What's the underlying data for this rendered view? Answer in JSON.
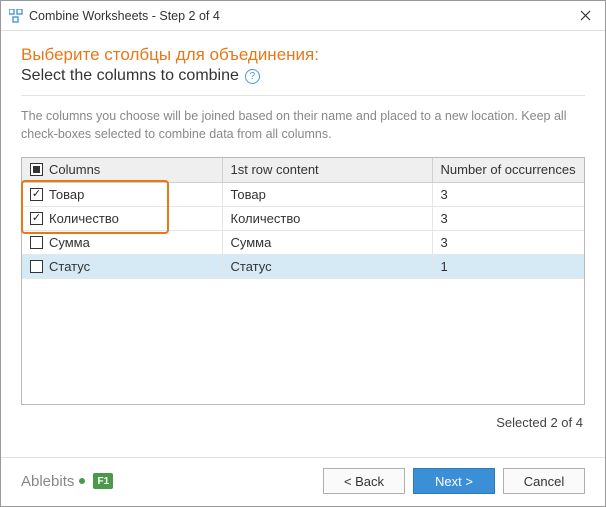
{
  "titlebar": {
    "title": "Combine Worksheets - Step 2 of 4"
  },
  "heading": {
    "ru": "Выберите столбцы для объединения:",
    "en": "Select the columns to combine"
  },
  "explain": "The columns you choose will be joined based on their name and placed to a new location. Keep all check-boxes selected to combine data from all columns.",
  "table": {
    "headers": {
      "col1": "Columns",
      "col2": "1st row content",
      "col3": "Number of occurrences"
    },
    "rows": [
      {
        "checked": true,
        "name": "Товар",
        "content": "Товар",
        "count": "3",
        "selected": false
      },
      {
        "checked": true,
        "name": "Количество",
        "content": "Количество",
        "count": "3",
        "selected": false
      },
      {
        "checked": false,
        "name": "Сумма",
        "content": "Сумма",
        "count": "3",
        "selected": false
      },
      {
        "checked": false,
        "name": "Статус",
        "content": "Статус",
        "count": "1",
        "selected": true
      }
    ]
  },
  "status": "Selected 2 of 4",
  "footer": {
    "brand": "Ablebits",
    "f1": "F1",
    "back": "< Back",
    "next": "Next >",
    "cancel": "Cancel"
  }
}
